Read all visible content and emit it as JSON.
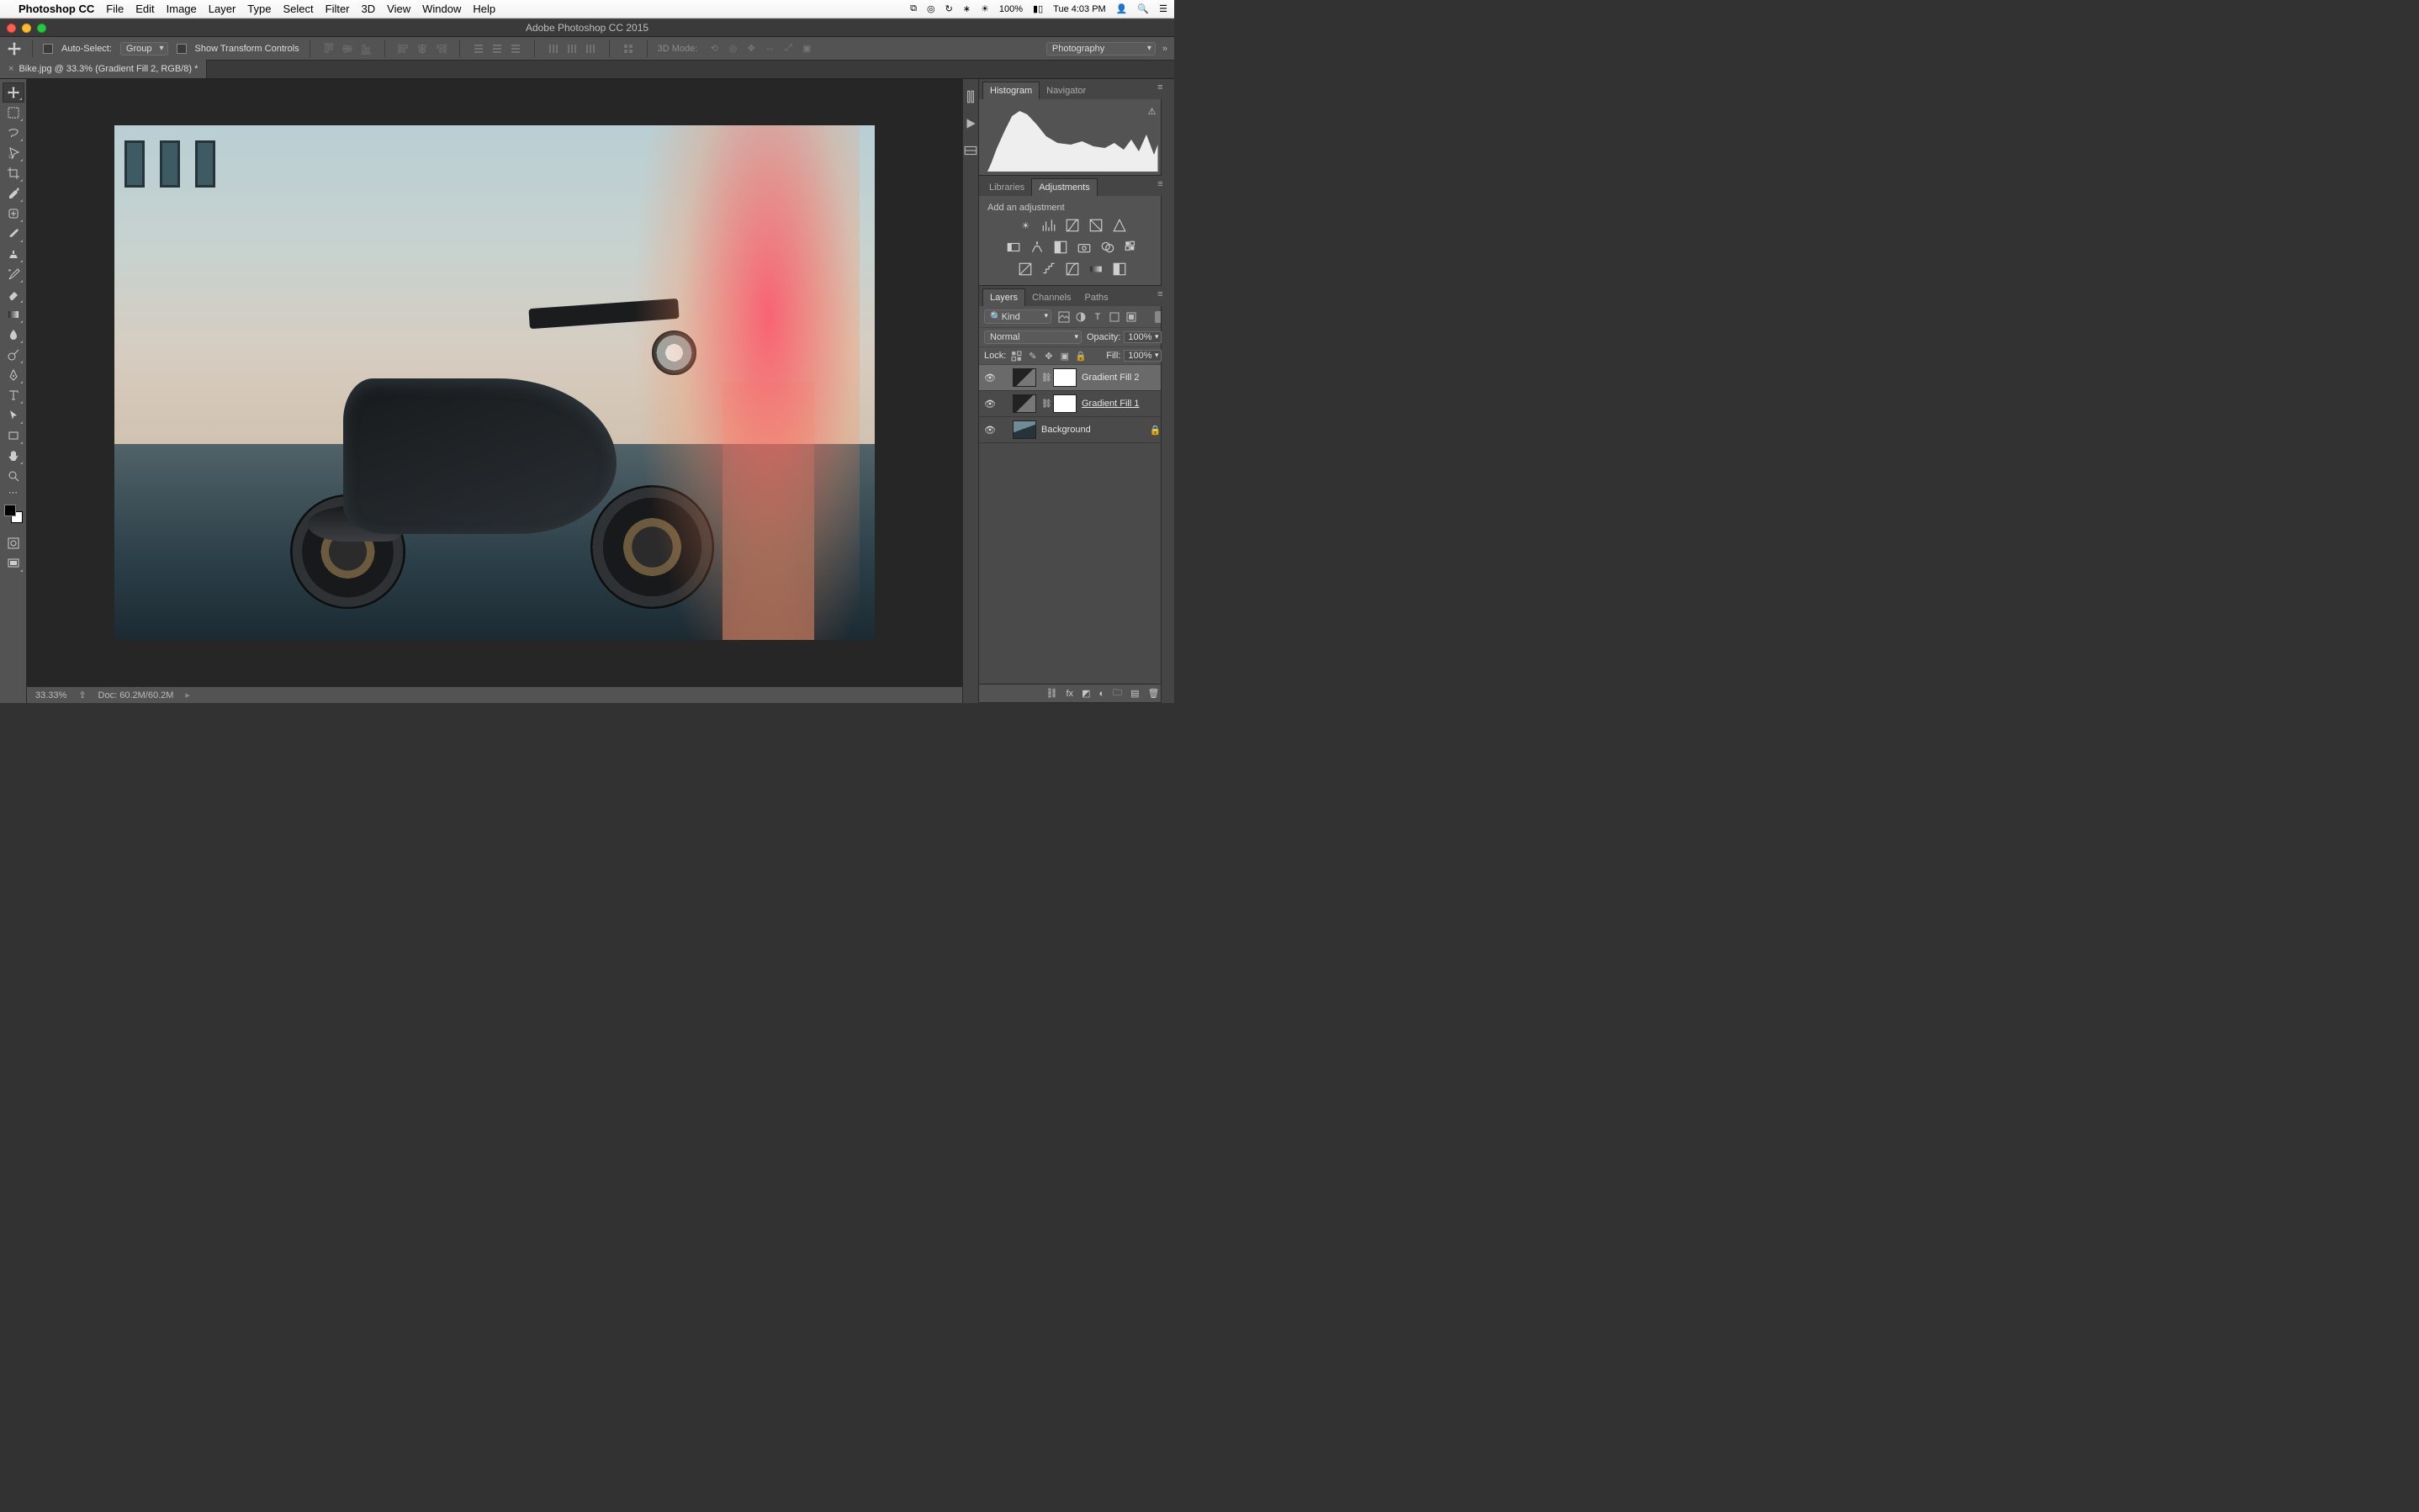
{
  "macmenu": {
    "app": "Photoshop CC",
    "items": [
      "File",
      "Edit",
      "Image",
      "Layer",
      "Type",
      "Select",
      "Filter",
      "3D",
      "View",
      "Window",
      "Help"
    ],
    "battery": "100%",
    "clock": "Tue 4:03 PM"
  },
  "window": {
    "title": "Adobe Photoshop CC 2015"
  },
  "options": {
    "auto_select": "Auto-Select:",
    "group": "Group",
    "show_tc": "Show Transform Controls",
    "mode3d": "3D Mode:",
    "workspace": "Photography"
  },
  "doc_tab": {
    "close": "×",
    "title": "Bike.jpg @ 33.3% (Gradient Fill 2, RGB/8) *"
  },
  "status": {
    "zoom": "33.33%",
    "doc": "Doc: 60.2M/60.2M"
  },
  "panels": {
    "histogram_tab": "Histogram",
    "navigator_tab": "Navigator",
    "libraries_tab": "Libraries",
    "adjustments_tab": "Adjustments",
    "add_adj": "Add an adjustment",
    "layers_tab": "Layers",
    "channels_tab": "Channels",
    "paths_tab": "Paths"
  },
  "layers": {
    "kind_label": "Kind",
    "blend": "Normal",
    "opacity_label": "Opacity:",
    "opacity_val": "100%",
    "lock_label": "Lock:",
    "fill_label": "Fill:",
    "fill_val": "100%",
    "items": [
      {
        "name": "Gradient Fill 2",
        "type": "gradient",
        "sel": true
      },
      {
        "name": "Gradient Fill 1",
        "type": "gradient",
        "underline": true
      },
      {
        "name": "Background",
        "type": "image",
        "locked": true
      }
    ]
  }
}
